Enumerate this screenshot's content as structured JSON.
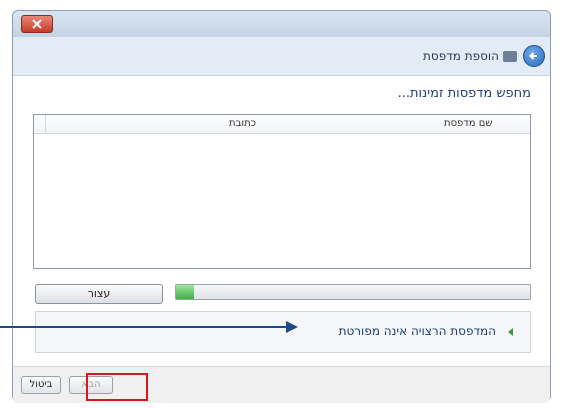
{
  "window": {
    "title": "הוספת מדפסת",
    "heading": "מחפש מדפסות זמינות..."
  },
  "printer_list": {
    "columns": [
      "שם מדפסת",
      "כתובת"
    ],
    "rows": []
  },
  "progress": {
    "fraction": 0.05,
    "stop_label": "עצור"
  },
  "message": {
    "text": "המדפסת הרצויה אינה מפורטת"
  },
  "footer": {
    "next_label": "הבא",
    "cancel_label": "ביטול"
  },
  "colors": {
    "highlight": "#d9161b",
    "pointer": "#1f4a8a",
    "progress_fill": "#3bb143"
  }
}
